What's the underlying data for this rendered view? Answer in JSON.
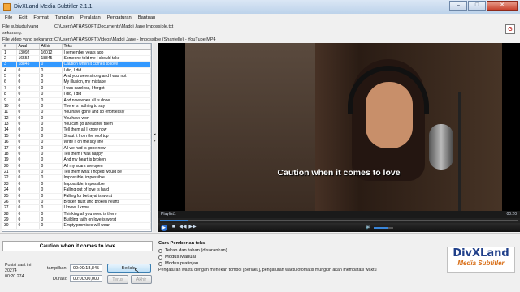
{
  "window": {
    "title": "DivXLand Media Subtitler 2.1.1"
  },
  "menu": [
    "File",
    "Edit",
    "Format",
    "Tampilan",
    "Peralatan",
    "Pengaturan",
    "Bantuan"
  ],
  "files": {
    "subtitle_label": "File subjudul yang sekarang:",
    "subtitle_path": "C:\\Users\\ATHASOFT\\Documents\\Maddi Jane Impossible.txt",
    "video_label": "File video yang sekarang:",
    "video_path": "C:\\Users\\ATHASOFT\\Videos\\Maddi Jane - Impossible (Shantelle) - YouTube.MP4"
  },
  "table": {
    "headers": [
      "#",
      "Awal",
      "Akhir",
      "Teks"
    ],
    "rows": [
      [
        "1",
        "13092",
        "16012",
        "I remember years ago"
      ],
      [
        "2",
        "16554",
        "18845",
        "Someone told me I should take"
      ],
      [
        "3",
        "18845",
        "0",
        "Caution when it comes to love"
      ],
      [
        "4",
        "0",
        "0",
        "I did, I did"
      ],
      [
        "5",
        "0",
        "0",
        "And you were strong and I was not"
      ],
      [
        "6",
        "0",
        "0",
        "My illusion, my mistake"
      ],
      [
        "7",
        "0",
        "0",
        "I was careless, I forgot"
      ],
      [
        "8",
        "0",
        "0",
        "I did, I did"
      ],
      [
        "9",
        "0",
        "0",
        "And now when all is done"
      ],
      [
        "10",
        "0",
        "0",
        "There is nothing to say"
      ],
      [
        "11",
        "0",
        "0",
        "You have gone and so effortlessly"
      ],
      [
        "12",
        "0",
        "0",
        "You have won"
      ],
      [
        "13",
        "0",
        "0",
        "You can go ahead tell them"
      ],
      [
        "14",
        "0",
        "0",
        "Tell them all I know now"
      ],
      [
        "15",
        "0",
        "0",
        "Shout it from the roof top"
      ],
      [
        "16",
        "0",
        "0",
        "Write it on the sky line"
      ],
      [
        "17",
        "0",
        "0",
        "All we had is gone now"
      ],
      [
        "18",
        "0",
        "0",
        "Tell them I was happy"
      ],
      [
        "19",
        "0",
        "0",
        "And my heart is broken"
      ],
      [
        "20",
        "0",
        "0",
        "All my scars are open"
      ],
      [
        "21",
        "0",
        "0",
        "Tell them what I hoped would be"
      ],
      [
        "22",
        "0",
        "0",
        "Impossible, impossible"
      ],
      [
        "23",
        "0",
        "0",
        "Impossible, impossible"
      ],
      [
        "24",
        "0",
        "0",
        "Falling out of love is hard"
      ],
      [
        "25",
        "0",
        "0",
        "Falling for betrayal is worst"
      ],
      [
        "26",
        "0",
        "0",
        "Broken trust and broken hearts"
      ],
      [
        "27",
        "0",
        "0",
        "I know, I know"
      ],
      [
        "28",
        "0",
        "0",
        "Thinking all you need is there"
      ],
      [
        "29",
        "0",
        "0",
        "Building faith on love is worst"
      ],
      [
        "30",
        "0",
        "0",
        "Empty promises will wear"
      ]
    ],
    "selected_index": 2
  },
  "player": {
    "subtitle_overlay": "Caution when it comes to love",
    "playlist_label": "Playlist1",
    "time_display": "00:20",
    "progress": 0.08,
    "volume": 0.7,
    "buttons": {
      "play": "▶",
      "stop": "■",
      "prev": "◀◀",
      "next": "▶▶",
      "mute": "🔈"
    }
  },
  "bottom": {
    "preview_text": "Caution when it comes to love",
    "position_label": "Posisi saat ini",
    "position_value": "20274",
    "position_time": "00:20.274",
    "show_label": "tampilkan:",
    "show_value": "00:00:18,845",
    "duration_label": "Durasi:",
    "duration_value": "00:00:00,000",
    "next_button": "Berlaku",
    "prev_button": "Terus",
    "end_button": "Akhir",
    "mode_heading": "Cara Pemberian teks",
    "modes": [
      {
        "label": "Tekan dan tahan (disarankan)",
        "selected": true
      },
      {
        "label": "Modus Manual",
        "selected": false
      },
      {
        "label": "Modus pratinjau",
        "selected": false
      }
    ],
    "note": "Pengaturan waktu dengan menekan tombol [Berlaku], pengaturan waktu otomatis mungkin akan membatasi waktu"
  },
  "logo": {
    "line1": "DivXLand",
    "line2": "Media Subtitler"
  }
}
